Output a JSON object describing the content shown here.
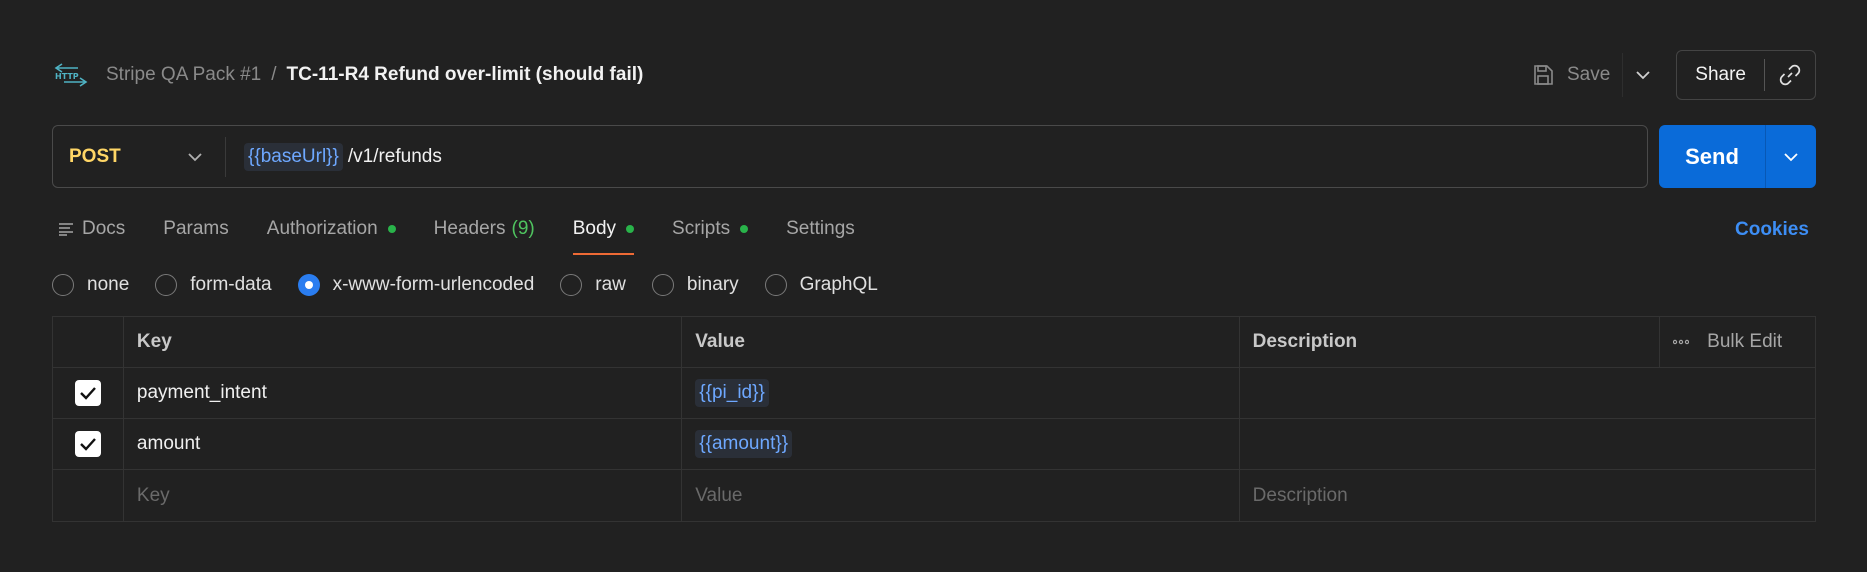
{
  "header": {
    "collection": "Stripe QA Pack #1",
    "separator": "/",
    "request_name": "TC-11-R4 Refund over-limit (should fail)",
    "save_label": "Save",
    "share_label": "Share"
  },
  "urlbar": {
    "method": "POST",
    "url_variable": "{{baseUrl}}",
    "url_path": "/v1/refunds",
    "send_label": "Send"
  },
  "tabs": [
    {
      "label": "Docs"
    },
    {
      "label": "Params"
    },
    {
      "label": "Authorization"
    },
    {
      "label": "Headers",
      "count": "(9)"
    },
    {
      "label": "Body"
    },
    {
      "label": "Scripts"
    },
    {
      "label": "Settings"
    }
  ],
  "cookies_label": "Cookies",
  "body_types": [
    {
      "label": "none",
      "selected": false
    },
    {
      "label": "form-data",
      "selected": false
    },
    {
      "label": "x-www-form-urlencoded",
      "selected": true
    },
    {
      "label": "raw",
      "selected": false
    },
    {
      "label": "binary",
      "selected": false
    },
    {
      "label": "GraphQL",
      "selected": false
    }
  ],
  "table": {
    "headers": {
      "key": "Key",
      "value": "Value",
      "description": "Description",
      "bulk_edit": "Bulk Edit"
    },
    "rows": [
      {
        "key": "payment_intent",
        "value": "{{pi_id}}",
        "checked": true
      },
      {
        "key": "amount",
        "value": "{{amount}}",
        "checked": true
      }
    ],
    "placeholders": {
      "key": "Key",
      "value": "Value",
      "description": "Description"
    }
  },
  "colors": {
    "method": "#ffd666",
    "send": "#0a6bd9",
    "variable": "#6ea8ff",
    "active_tab_underline": "#ee6a35",
    "status_dot": "#29b34a",
    "cookies": "#3d8ef5"
  }
}
